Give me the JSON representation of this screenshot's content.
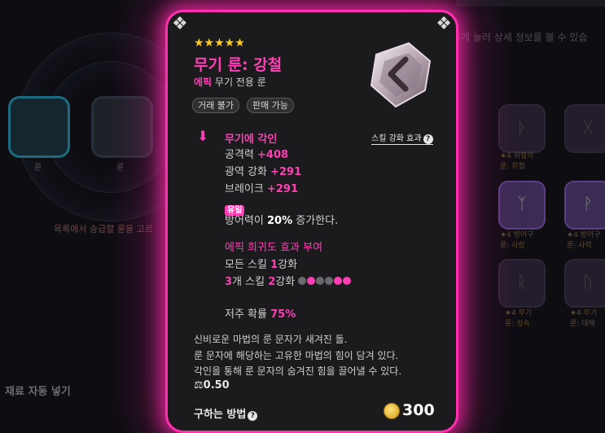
{
  "background": {
    "hint_text": "목록에서 승급할 룬을 고르",
    "auto_fill_label": "재료 자동 넣기",
    "top_right_text": "길게 눌러 상세 정보를 볼 수 있습",
    "slot1_label": "룬",
    "slot2_label": "룬",
    "rune_caps": [
      {
        "line1": "★4 위협의",
        "line2": "룬: 위협"
      },
      {
        "line1": "★4 방어구",
        "line2": "룬: 사랑"
      },
      {
        "line1": "★4 방어구",
        "line2": "룬: 사력"
      },
      {
        "line1": "★4 무기",
        "line2": "룬: 성속"
      },
      {
        "line1": "★4 무기",
        "line2": "룬: 대해"
      }
    ]
  },
  "tooltip": {
    "stars": "★★★★★",
    "title": "무기 룬: 강철",
    "grade": "에픽",
    "subtitle_rest": " 무기 전용 룬",
    "tags": [
      "거래 불가",
      "판매 가능"
    ],
    "engrave_title": "무기에 각인",
    "skill_help_label": "스킬 강화 효과",
    "stats": [
      {
        "name": "공격력 ",
        "value": "+408"
      },
      {
        "name": "광역 강화 ",
        "value": "+291"
      },
      {
        "name": "브레이크 ",
        "value": "+291"
      }
    ],
    "unique_badge": "유일",
    "defense_prefix": "방어력이 ",
    "defense_value": "20%",
    "defense_suffix": " 증가한다.",
    "rarity_title": "에픽 희귀도 효과 부여",
    "all_skill_prefix": "모든 스킬 ",
    "all_skill_value": "1",
    "all_skill_suffix": "강화",
    "three_skill_count": "3",
    "three_skill_mid": "개 스킬 ",
    "three_skill_value": "2",
    "three_skill_suffix": "강화",
    "skill_dots": [
      false,
      true,
      false,
      false,
      true,
      true
    ],
    "curse_label": "저주 확률 ",
    "curse_value": "75%",
    "description": [
      "신비로운 마법의 룬 문자가 새겨진 돌.",
      "룬 문자에 해당하는 고유한 마법의 힘이 담겨 있다.",
      "각인을 통해 룬 문자의 숨겨진 힘을 끌어낼 수 있다."
    ],
    "weight": "0.50",
    "obtain_label": "구하는 방법",
    "price": "300",
    "colors": {
      "accent": "#ff3fb5",
      "gold": "#ffcc1a",
      "panel": "#1b1b1d"
    }
  }
}
